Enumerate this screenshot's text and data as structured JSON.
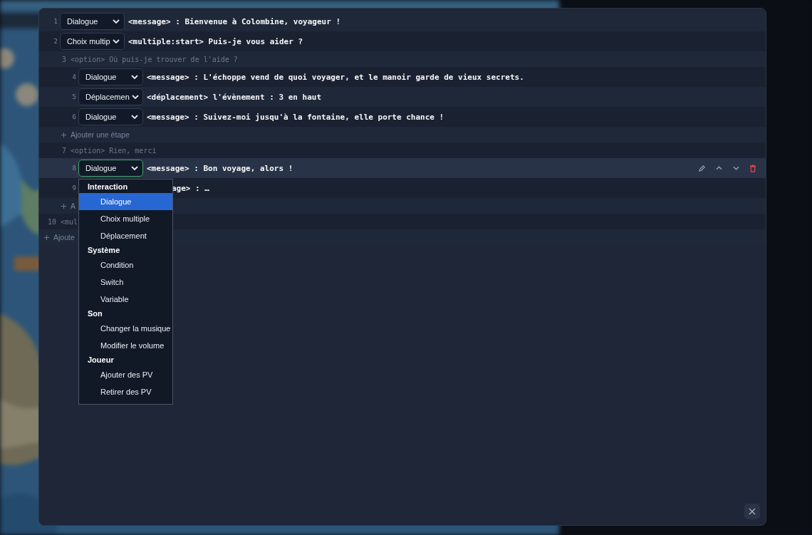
{
  "steps": [
    {
      "kind": "step",
      "number": "1",
      "type": "Dialogue",
      "text": "<message> : Bienvenue à Colombine, voyageur !",
      "active": false
    },
    {
      "kind": "step",
      "number": "2",
      "type": "Choix multip",
      "text": "<multiple:start> Puis-je vous aider ?",
      "active": false,
      "children": [
        {
          "kind": "option",
          "number": "3",
          "text": "<option> Où puis-je trouver de l'aide ?",
          "children": [
            {
              "kind": "step",
              "number": "4",
              "type": "Dialogue",
              "text": "<message> : L'échoppe vend de quoi voyager, et le manoir garde de vieux secrets.",
              "active": false
            },
            {
              "kind": "step",
              "number": "5",
              "type": "Déplacemen",
              "text": "<déplacement> l'évènement : 3 en haut",
              "active": false
            },
            {
              "kind": "step",
              "number": "6",
              "type": "Dialogue",
              "text": "<message> : Suivez-moi jusqu'à la fontaine, elle porte chance !",
              "active": false
            },
            {
              "kind": "add",
              "label": "Ajouter une étape"
            }
          ]
        },
        {
          "kind": "option",
          "number": "7",
          "text": "<option> Rien, merci",
          "children": [
            {
              "kind": "step",
              "number": "8",
              "type": "Dialogue",
              "text": "<message> : Bon voyage, alors !",
              "active": true,
              "menu": [
                {
                  "label": "Interaction",
                  "items": [
                    {
                      "label": "Dialogue",
                      "selected": true
                    },
                    {
                      "label": "Choix multiple",
                      "selected": false
                    },
                    {
                      "label": "Déplacement",
                      "selected": false
                    }
                  ]
                },
                {
                  "label": "Système",
                  "items": [
                    {
                      "label": "Condition",
                      "selected": false
                    },
                    {
                      "label": "Switch",
                      "selected": false
                    },
                    {
                      "label": "Variable",
                      "selected": false
                    }
                  ]
                },
                {
                  "label": "Son",
                  "items": [
                    {
                      "label": "Changer la musique",
                      "selected": false
                    },
                    {
                      "label": "Modifier le volume",
                      "selected": false
                    }
                  ]
                },
                {
                  "label": "Joueur",
                  "items": [
                    {
                      "label": "Ajouter des PV",
                      "selected": false
                    },
                    {
                      "label": "Retirer des PV",
                      "selected": false
                    }
                  ]
                }
              ]
            },
            {
              "kind": "step",
              "number": "9",
              "text": "age> : …",
              "active": false
            },
            {
              "kind": "add",
              "label": "A"
            }
          ]
        }
      ]
    },
    {
      "kind": "option",
      "number": "10",
      "text": "<mul"
    },
    {
      "kind": "add",
      "label": "Ajoute"
    }
  ]
}
